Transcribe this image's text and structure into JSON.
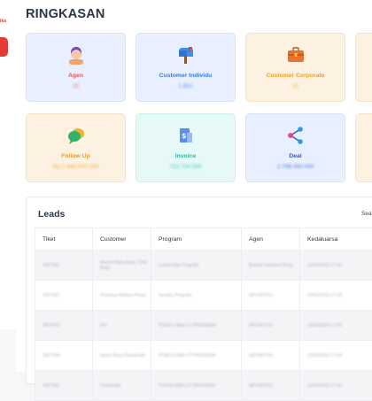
{
  "sidebar": {
    "brand_text": "iks",
    "accent": "#e53935"
  },
  "page": {
    "title": "RINGKASAN"
  },
  "summary_cards": [
    {
      "label": "Agen",
      "value": "15",
      "icon": "user-avatar-icon",
      "bg": "#e8effe",
      "text_color": "#e2574c"
    },
    {
      "label": "Customer Individu",
      "value": "1.851",
      "icon": "mailbox-icon",
      "bg": "#e8effe",
      "text_color": "#3a7be0"
    },
    {
      "label": "Customer Corporate",
      "value": "11",
      "icon": "briefcase-icon",
      "bg": "#fdf1e2",
      "text_color": "#e8a02b"
    },
    {
      "label": "Follow Up",
      "value": "Rp 1.660.650.000",
      "icon": "chat-bubbles-icon",
      "bg": "#fdf1e2",
      "text_color": "#e8a02b"
    },
    {
      "label": "Invoice",
      "value": "722.700.000",
      "icon": "invoice-icon",
      "bg": "#e6f9f6",
      "text_color": "#25b7a6"
    },
    {
      "label": "Deal",
      "value": "2.798.050.000",
      "icon": "share-nodes-icon",
      "bg": "#e8effe",
      "text_color": "#2e5fd0"
    }
  ],
  "leads": {
    "title": "Leads",
    "see_all_label": "Sea",
    "columns": [
      "Tiket",
      "Customer",
      "Program",
      "Agen",
      "Kedaluarsa"
    ],
    "rows": [
      [
        "2007001",
        "Rachel Mary Andy 1904 Andy",
        "Leadership Program",
        "Budiati Febriana Rosa",
        "10/01/2023 17:24"
      ],
      [
        "2007002",
        "Prasetya Baktiyo Prayo",
        "Sunday Program",
        "ARYANTOS",
        "10/01/2023 17:24"
      ],
      [
        "2007003",
        "Net",
        "PONOLOMA LIT PROGRAM",
        "ARYANTOS",
        "10/01/2023 17:24"
      ],
      [
        "2007004",
        "Ayuni Maya Perkamdiv",
        "PONOLOMA LIT PROGRAM",
        "ARYANTOS",
        "10/01/2023 17:24"
      ],
      [
        "2007005",
        "Perkamdiv",
        "PONOLOMA LIT PROGRAM",
        "ARYANTOS",
        "10/01/2023 17:24"
      ]
    ]
  }
}
